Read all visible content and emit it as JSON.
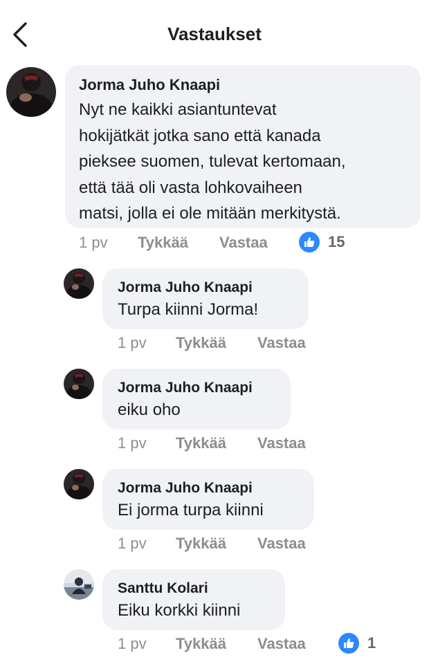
{
  "header": {
    "title": "Vastaukset",
    "back_icon": "chevron-left-icon"
  },
  "colors": {
    "bubble": "#f0f2f5",
    "meta_text": "#8a8d91",
    "like_blue": "#2d88ff"
  },
  "comments": [
    {
      "author": "Jorma Juho Knaapi",
      "lines": [
        "Nyt ne kaikki asiantuntevat",
        "hokijätkät jotka sano että kanada",
        "pieksee suomen, tulevat kertomaan,",
        "että tää oli vasta lohkovaiheen",
        "matsi, jolla ei ole mitään merkitystä."
      ],
      "time": "1 pv",
      "like_label": "Tykkää",
      "reply_label": "Vastaa",
      "reactions": "15"
    },
    {
      "author": "Jorma Juho Knaapi",
      "text": "Turpa kiinni Jorma!",
      "time": "1 pv",
      "like_label": "Tykkää",
      "reply_label": "Vastaa"
    },
    {
      "author": "Jorma Juho Knaapi",
      "text": "eiku oho",
      "time": "1 pv",
      "like_label": "Tykkää",
      "reply_label": "Vastaa"
    },
    {
      "author": "Jorma Juho Knaapi",
      "text": "Ei jorma turpa kiinni",
      "time": "1 pv",
      "like_label": "Tykkää",
      "reply_label": "Vastaa"
    },
    {
      "author": "Santtu Kolari",
      "text": "Eiku korkki kiinni",
      "time": "1 pv",
      "like_label": "Tykkää",
      "reply_label": "Vastaa",
      "reactions": "1"
    }
  ]
}
